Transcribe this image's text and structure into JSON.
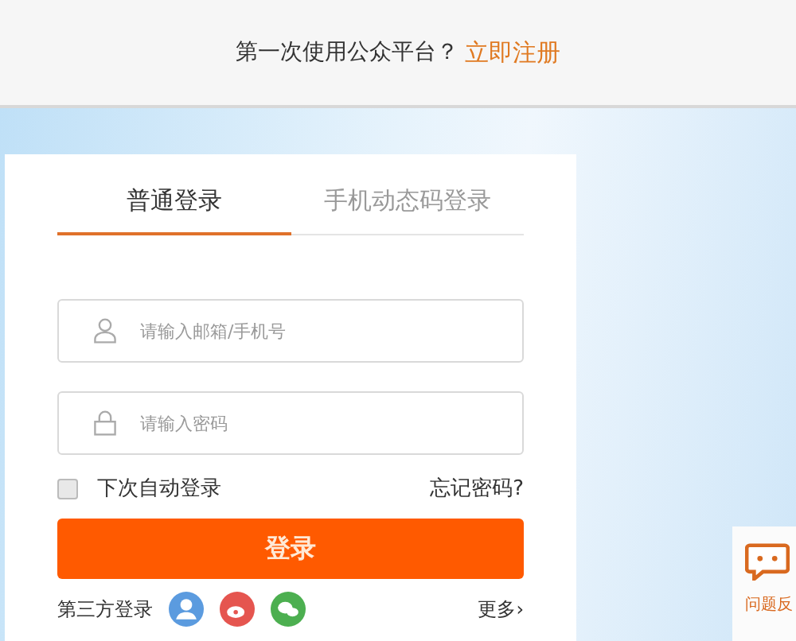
{
  "top_bar": {
    "prompt": "第一次使用公众平台？",
    "register_link": "立即注册"
  },
  "tabs": [
    {
      "label": "普通登录",
      "selected": true
    },
    {
      "label": "手机动态码登录",
      "selected": false
    }
  ],
  "fields": [
    {
      "kind": "user",
      "placeholder": "请输入邮箱/手机号"
    },
    {
      "kind": "lock",
      "placeholder": "请输入密码"
    }
  ],
  "remember": {
    "label": "下次自动登录",
    "checked": false
  },
  "forgot_link": "忘记密码?",
  "login_button": "登录",
  "third_party": {
    "label": "第三方登录",
    "providers": [
      {
        "kind": "person",
        "color": "#5b9bdf"
      },
      {
        "kind": "weibo",
        "color": "#e5554f"
      },
      {
        "kind": "chat",
        "color": "#4caf50"
      }
    ],
    "more": "更多›"
  },
  "feedback": {
    "label": "问题反"
  }
}
